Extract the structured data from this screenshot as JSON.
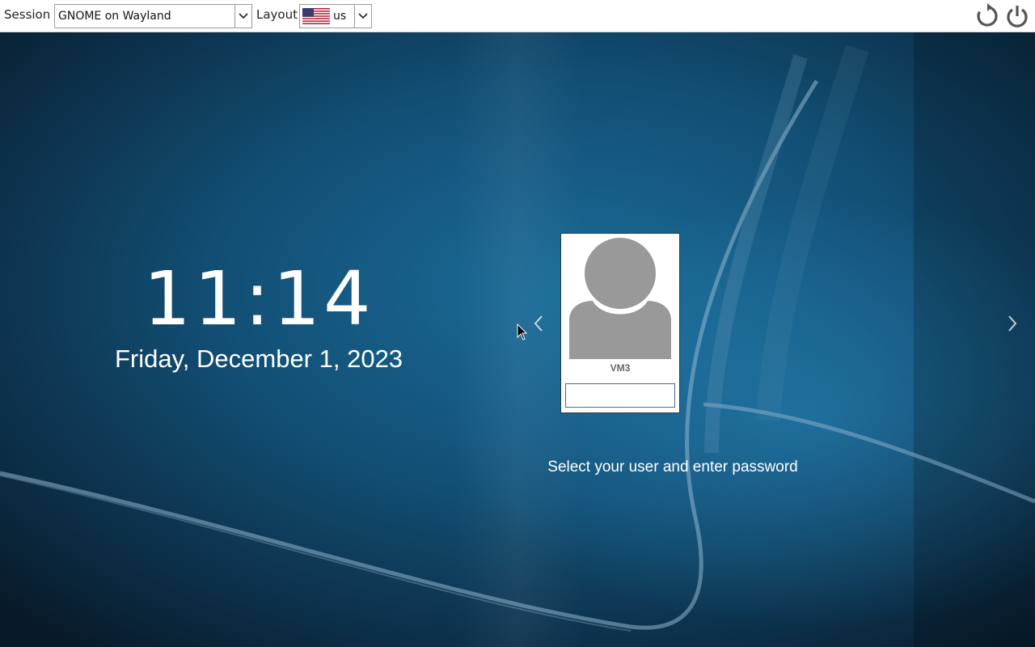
{
  "topbar": {
    "session_label": "Session",
    "session_value": "GNOME on Wayland",
    "layout_label": "Layout",
    "layout_value": "us",
    "layout_flag_icon": "us-flag-icon",
    "restart_icon": "restart-icon",
    "power_icon": "power-icon"
  },
  "clock": {
    "time": "11:14",
    "date": "Friday, December 1, 2023"
  },
  "user_card": {
    "avatar_icon": "user-avatar-icon",
    "username": "VM3",
    "password_value": ""
  },
  "nav": {
    "prev_icon": "chevron-left-icon",
    "next_icon": "chevron-right-icon"
  },
  "hint": "Select your user and enter password",
  "colors": {
    "bg_dark": "#0a2236",
    "bg_mid": "#13587f",
    "bg_light": "#1a6e9b",
    "topbar": "#ffffff",
    "avatar_gray": "#999999"
  }
}
